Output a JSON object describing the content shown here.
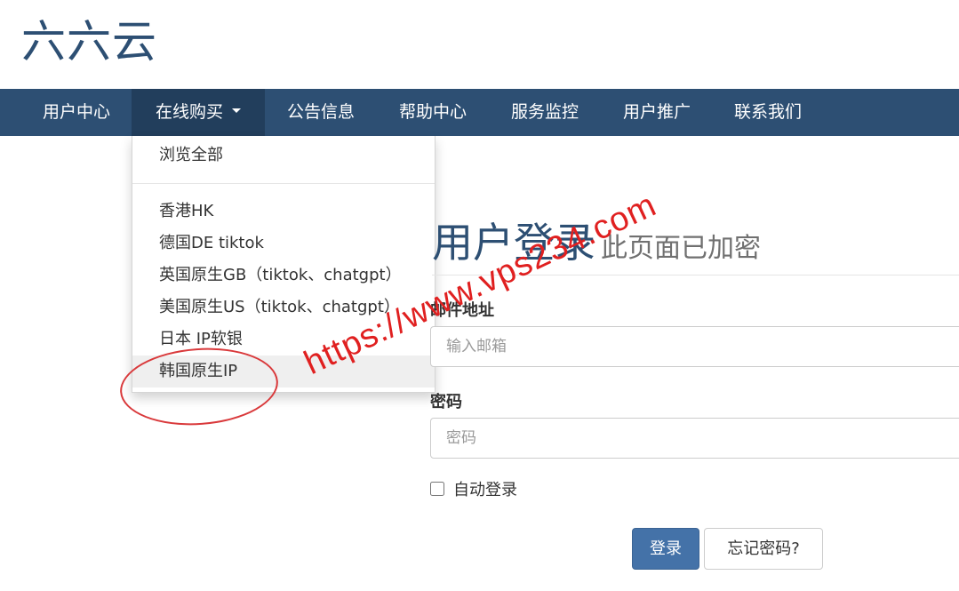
{
  "brand": "六六云",
  "nav": {
    "items": [
      "用户中心",
      "在线购买",
      "公告信息",
      "帮助中心",
      "服务监控",
      "用户推广",
      "联系我们"
    ],
    "active_index": 1
  },
  "dropdown": {
    "browse_all": "浏览全部",
    "items": [
      "香港HK",
      "德国DE tiktok",
      "英国原生GB（tiktok、chatgpt）",
      "美国原生US（tiktok、chatgpt）",
      "日本 IP软银",
      "韩国原生IP"
    ],
    "highlighted_index": 5
  },
  "login": {
    "title": "用户登录",
    "subtitle": "此页面已加密",
    "email_label": "邮件地址",
    "email_placeholder": "输入邮箱",
    "password_label": "密码",
    "password_placeholder": "密码",
    "remember_label": "自动登录",
    "remember_checked": false,
    "submit_label": "登录",
    "forgot_label": "忘记密码?"
  },
  "watermark": "https://www.vps234.com",
  "colors": {
    "navbar": "#2d4f73",
    "brand": "#2d4f73",
    "primary_button": "#4472a8",
    "watermark": "#e02020"
  }
}
